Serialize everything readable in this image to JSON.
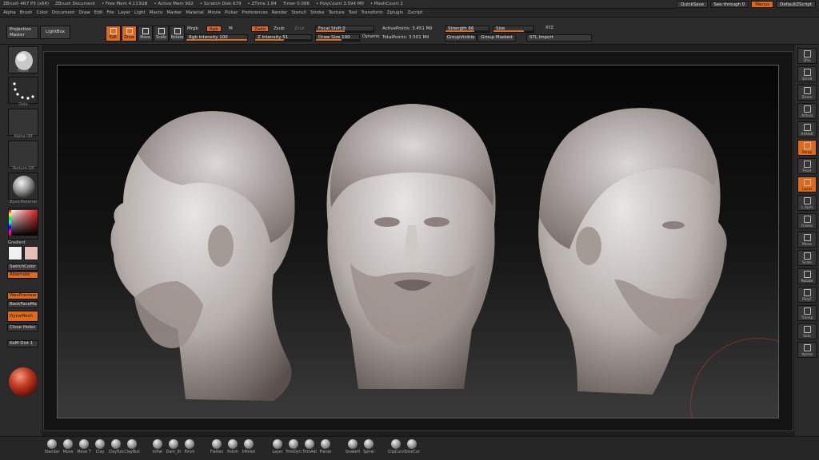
{
  "titlebar": {
    "items": [
      "ZBrush 4R7 P3 (x64)",
      "ZBrush Document",
      "• Free Mem 4.113GB",
      "• Active Mem 992",
      "• Scratch Disk 679",
      "• ZTime 1.84",
      "Timer 0.086",
      "• PolyCount 3.594 MP",
      "• MeshCount 2"
    ],
    "quicksave": "QuickSave",
    "seethrough": "See-through 0",
    "menus_label": "Menus",
    "defaultscript": "DefaultZScript"
  },
  "menubar": [
    "Alpha",
    "Brush",
    "Color",
    "Document",
    "Draw",
    "Edit",
    "File",
    "Layer",
    "Light",
    "Macro",
    "Marker",
    "Material",
    "Movie",
    "Picker",
    "Preferences",
    "Render",
    "Stencil",
    "Stroke",
    "Texture",
    "Tool",
    "Transform",
    "Zplugin",
    "Zscript"
  ],
  "toolbar": {
    "projection_master": "Projection Master",
    "lightbox": "LightBox",
    "tools": [
      {
        "label": "Edit",
        "icon": "edit-icon",
        "active": true
      },
      {
        "label": "Draw",
        "icon": "draw-icon",
        "active": true
      },
      {
        "label": "Move",
        "icon": "move-icon",
        "active": false
      },
      {
        "label": "Scale",
        "icon": "scale-icon",
        "active": false
      },
      {
        "label": "Rotate",
        "icon": "rotate-icon",
        "active": false
      }
    ],
    "mrgb": "Mrgb",
    "rgb": "Rgb",
    "m": "M",
    "rgb_intensity": "Rgb Intensity 100",
    "zadd": "Zadd",
    "zsub": "Zsub",
    "zcut": "Zcut",
    "z_intensity": "Z Intensity 51",
    "focal_shift": "Focal Shift 0",
    "draw_size": "Draw Size 100",
    "dynamic": "Dynamic",
    "active_points": "ActivePoints: 3.451 Mil",
    "total_points": "TotalPoints: 3.501 Mil",
    "strength": "Strength 66",
    "size": "Size",
    "xyz": "XYZ",
    "groupvisible": "GroupVisible",
    "group_masked": "Group Masked",
    "stl_import": "STL Import",
    "rgb_intensity_value": 100,
    "z_intensity_value": 51,
    "strength_value": 66
  },
  "leftshelf": {
    "labels": [
      "Move",
      "Dots",
      "Alpha Off",
      "Texture Off",
      "BasicMaterial"
    ],
    "gradient": "Gradient",
    "switchcolor": "SwitchColor",
    "alternate": "Alternate",
    "waxpreview": "WaxPreview",
    "backfacemask": "BackFaceMa",
    "dynamesh": "DynaMesh",
    "close_holes": "Close Holes",
    "kemdist": "KeM Dist 1",
    "color_main": "#f0f0f0",
    "color_secondary": "#e7bdb8"
  },
  "rightshelf": [
    {
      "label": "SPix",
      "orange": false
    },
    {
      "label": "Scroll",
      "orange": false
    },
    {
      "label": "Zoom",
      "orange": false
    },
    {
      "label": "Actual",
      "orange": false
    },
    {
      "label": "AAHalf",
      "orange": false
    },
    {
      "label": "Persp",
      "orange": true
    },
    {
      "label": "Floor",
      "orange": false
    },
    {
      "label": "Local",
      "orange": true
    },
    {
      "label": "L.Sym",
      "orange": false
    },
    {
      "label": "Frame",
      "orange": false
    },
    {
      "label": "Move",
      "orange": false
    },
    {
      "label": "Scale",
      "orange": false
    },
    {
      "label": "Rotate",
      "orange": false
    },
    {
      "label": "PolyF",
      "orange": false
    },
    {
      "label": "Transp",
      "orange": false
    },
    {
      "label": "Solo",
      "orange": false
    },
    {
      "label": "Xpose",
      "orange": false
    }
  ],
  "bottom_brushes": [
    "Standar",
    "Move",
    "Move T",
    "Clay",
    "ClayTub",
    "ClayBuil",
    "Inflat",
    "Dam_St",
    "Pinch",
    "Flatten",
    "Polish",
    "hPolish",
    "Layer",
    "TrimDyn",
    "TrimAdi",
    "Planar",
    "SnakeH",
    "Spiral",
    "ClipCurv",
    "SliceCur"
  ]
}
